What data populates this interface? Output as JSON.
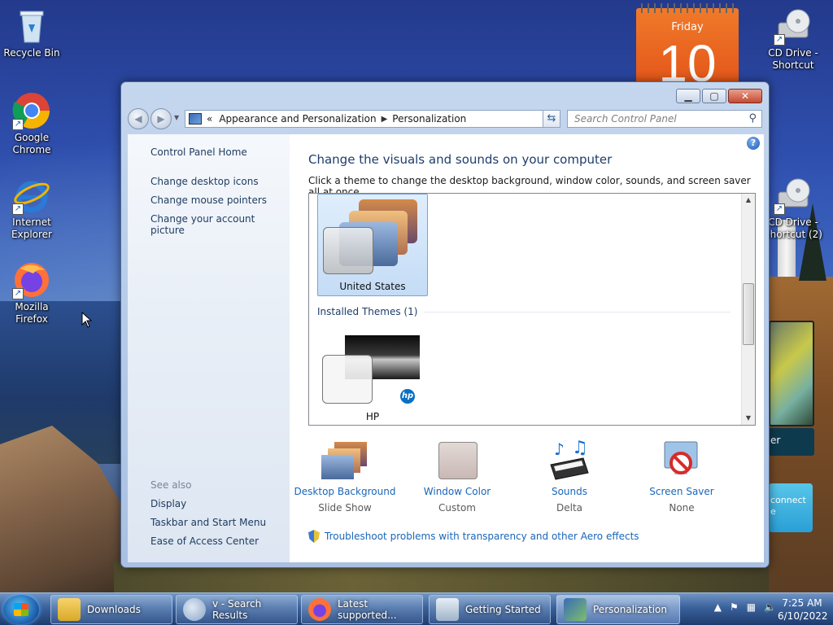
{
  "desktop": {
    "icons": [
      {
        "label": "Recycle Bin"
      },
      {
        "label": "Google Chrome"
      },
      {
        "label": "Internet Explorer"
      },
      {
        "label": "Mozilla Firefox"
      },
      {
        "label": "CD Drive - Shortcut"
      },
      {
        "label": "CD Drive - Shortcut (2)"
      }
    ],
    "calendar": {
      "day": "Friday",
      "date": "10"
    },
    "gadget_media_text": "er",
    "gadget_connect_text": "connect e"
  },
  "window": {
    "address": {
      "chevron": "«",
      "crumbs": [
        "Appearance and Personalization",
        "Personalization"
      ]
    },
    "search_placeholder": "Search Control Panel",
    "left": {
      "home": "Control Panel Home",
      "links": [
        "Change desktop icons",
        "Change mouse pointers",
        "Change your account picture"
      ],
      "see_also": "See also",
      "see_also_links": [
        "Display",
        "Taskbar and Start Menu",
        "Ease of Access Center"
      ]
    },
    "title": "Change the visuals and sounds on your computer",
    "subtitle": "Click a theme to change the desktop background, window color, sounds, and screen saver all at once.",
    "themes": {
      "selected": "United States",
      "group": "Installed Themes (1)",
      "installed": [
        "HP"
      ]
    },
    "bottom": [
      {
        "label": "Desktop Background",
        "value": "Slide Show"
      },
      {
        "label": "Window Color",
        "value": "Custom"
      },
      {
        "label": "Sounds",
        "value": "Delta"
      },
      {
        "label": "Screen Saver",
        "value": "None"
      }
    ],
    "troubleshoot": "Troubleshoot problems with transparency and other Aero effects"
  },
  "taskbar": {
    "buttons": [
      {
        "label": "Downloads"
      },
      {
        "label": "v - Search Results"
      },
      {
        "label": "Latest supported..."
      },
      {
        "label": "Getting Started"
      },
      {
        "label": "Personalization"
      }
    ],
    "time": "7:25 AM",
    "date": "6/10/2022"
  }
}
